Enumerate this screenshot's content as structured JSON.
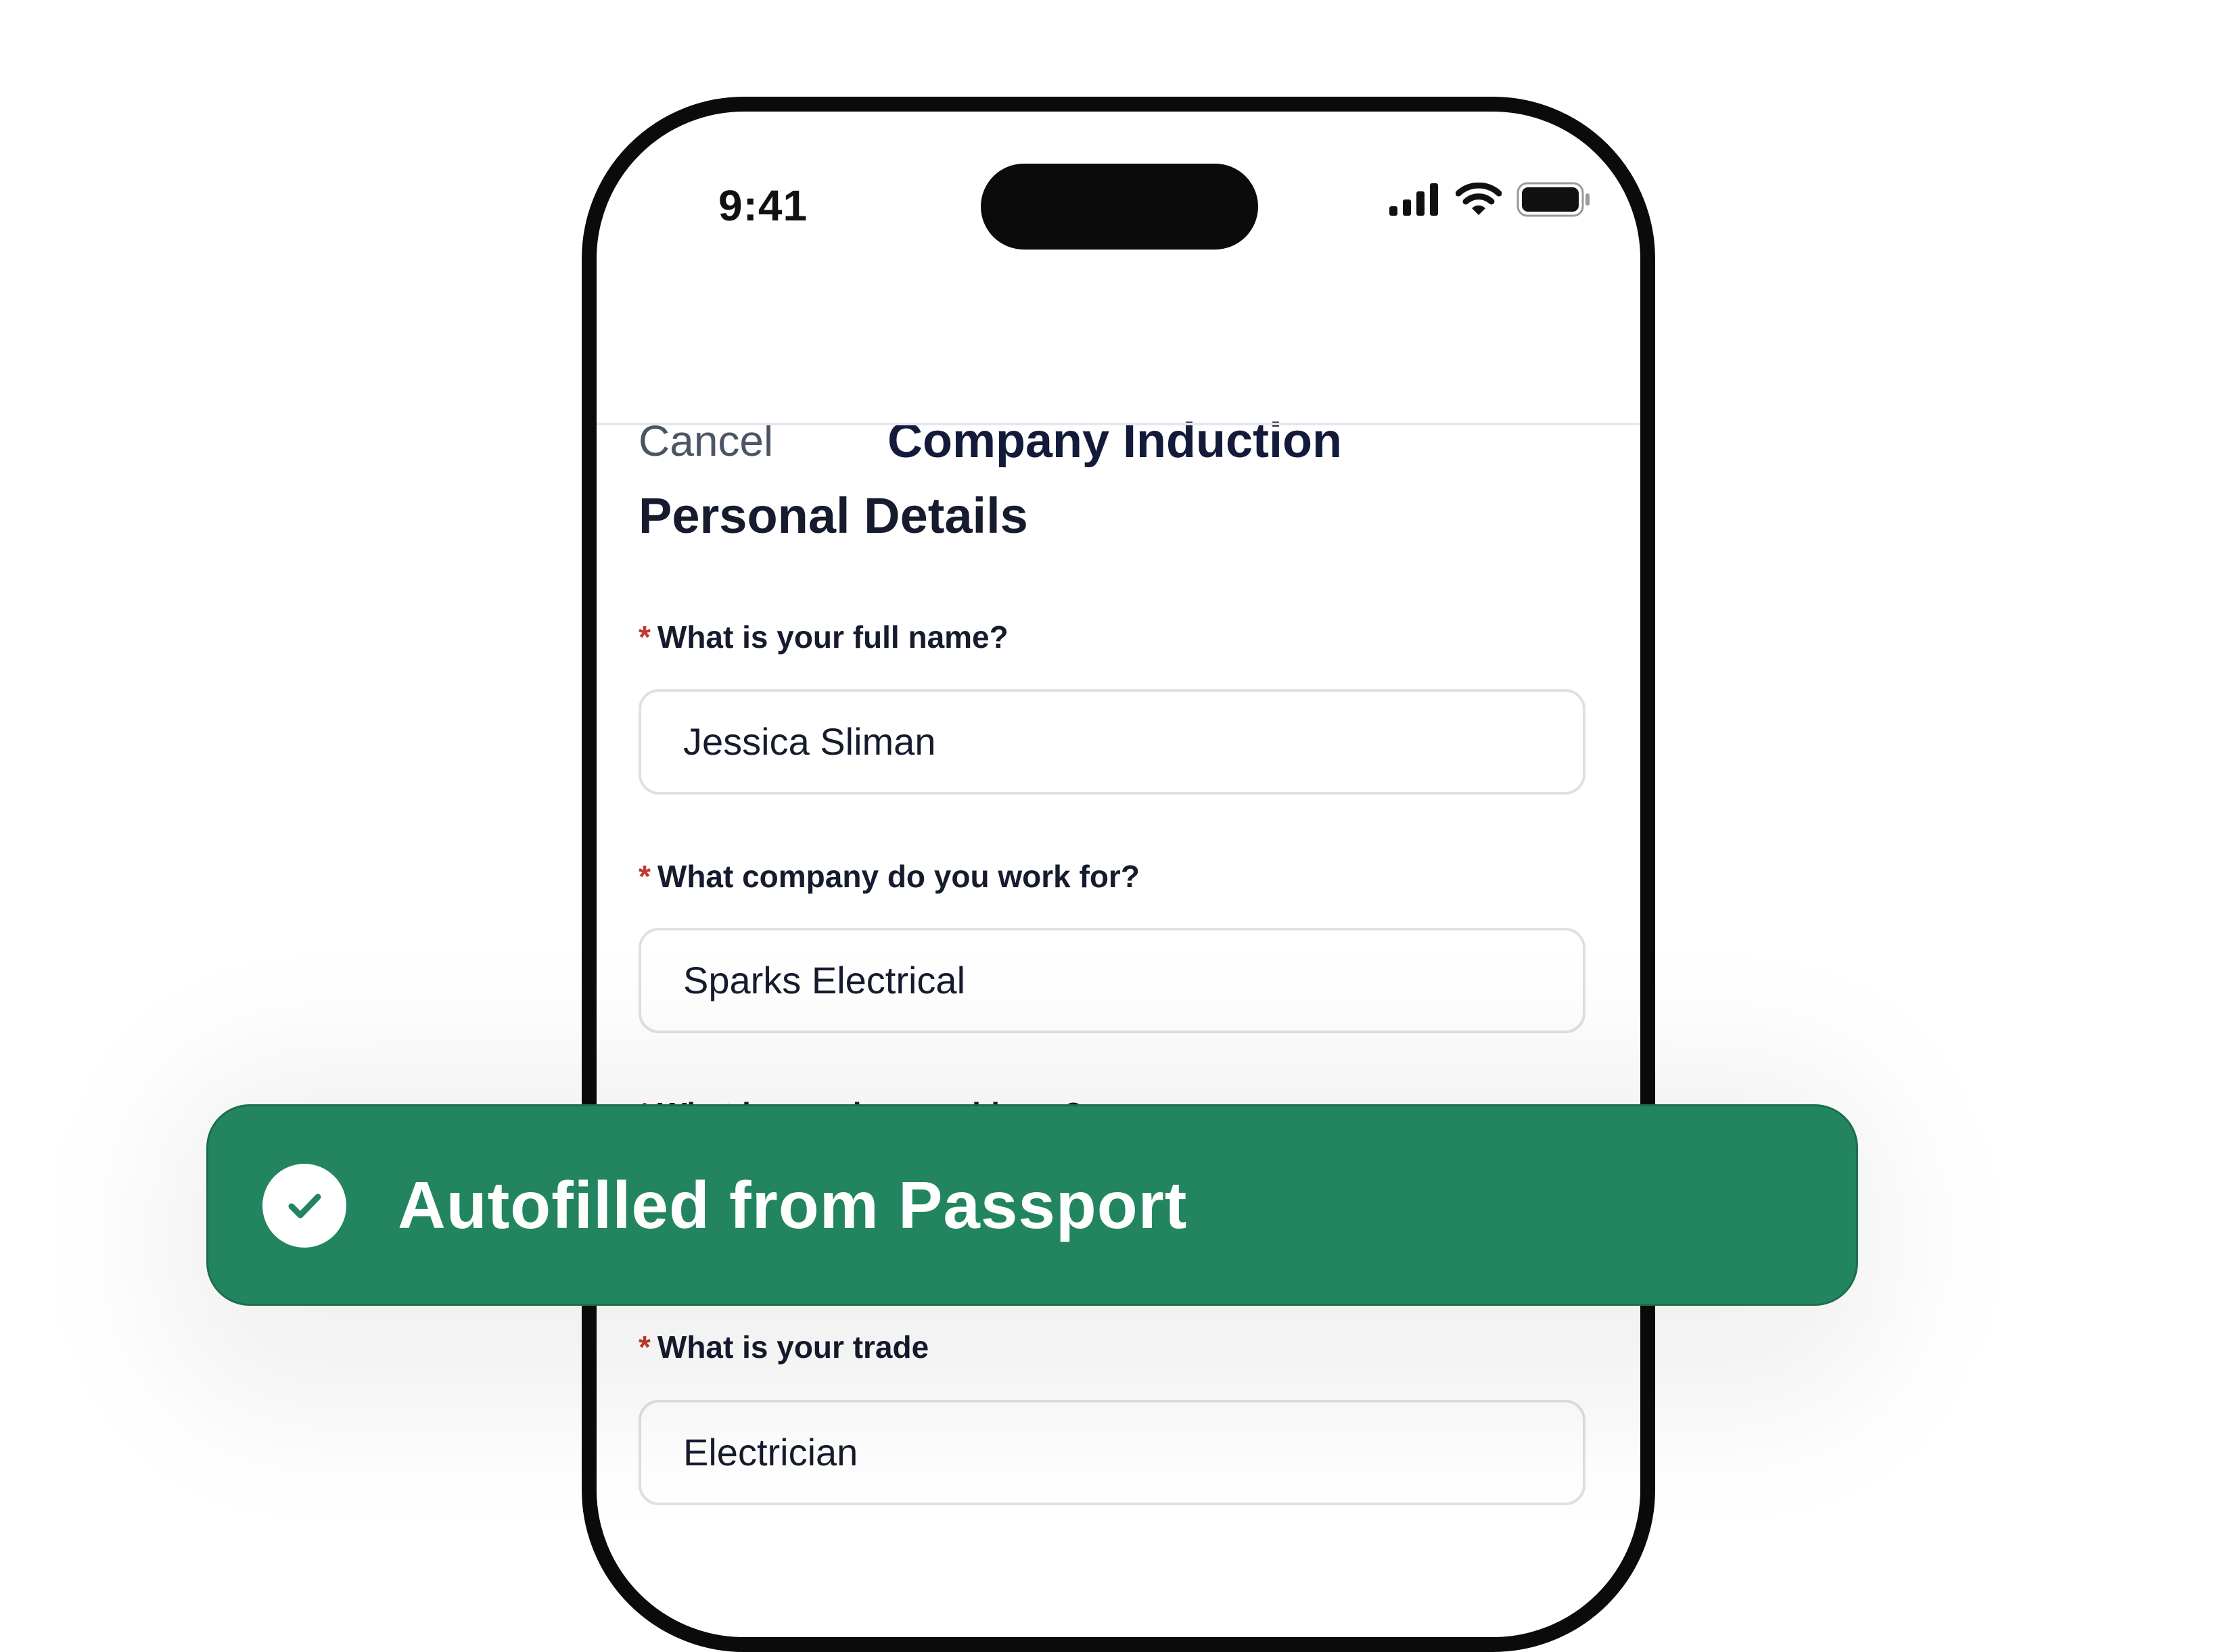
{
  "status_bar": {
    "time": "9:41",
    "icons": [
      "cellular-signal-icon",
      "wifi-icon",
      "battery-icon"
    ]
  },
  "nav": {
    "cancel_label": "Cancel",
    "title": "Company Induction"
  },
  "section": {
    "title": "Personal Details"
  },
  "fields": [
    {
      "required_mark": "*",
      "label": "What is your full name?",
      "value": "Jessica Sliman"
    },
    {
      "required_mark": "*",
      "label": "What company do you work for?",
      "value": "Sparks Electrical"
    },
    {
      "required_mark": "*",
      "label": "What is your home address?",
      "value": ""
    },
    {
      "required_mark": "*",
      "label": "What is your trade",
      "value": "Electrician"
    }
  ],
  "toast": {
    "icon": "check-circle-icon",
    "message": "Autofilled from Passport"
  },
  "colors": {
    "toast_background": "#22855f",
    "required_asterisk": "#c0392b",
    "title_text": "#141a3a"
  }
}
